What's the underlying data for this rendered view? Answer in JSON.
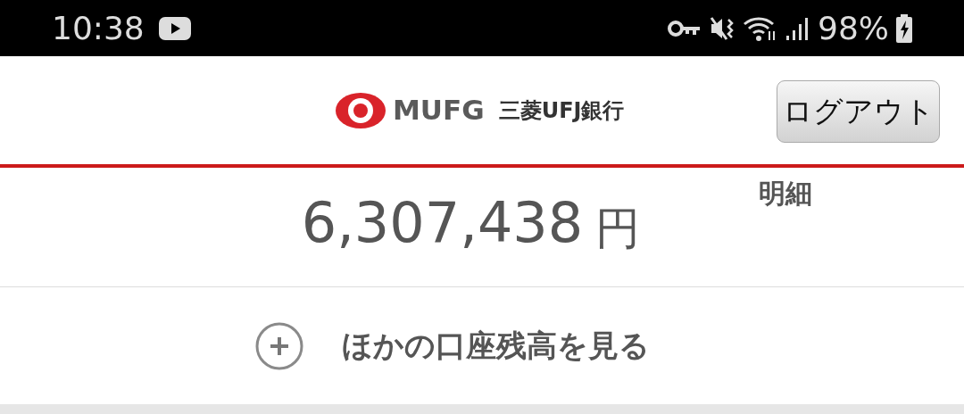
{
  "status_bar": {
    "time": "10:38",
    "battery": "98%"
  },
  "header": {
    "logo_brand": "MUFG",
    "logo_bank": "三菱UFJ銀行",
    "logout_button": "ログアウト"
  },
  "balance": {
    "amount": "6,307,438",
    "currency": "円",
    "details_link": "明細"
  },
  "more_accounts": {
    "label": "ほかの口座残高を見る"
  }
}
